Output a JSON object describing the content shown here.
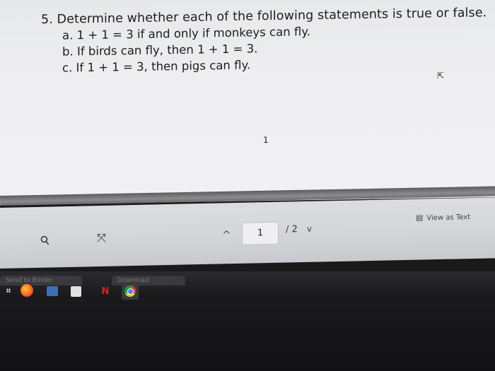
{
  "document": {
    "problem_statement": "5. Determine whether each of the following statements is true or false.",
    "items": [
      "a. 1 + 1 = 3 if and only if monkeys can fly.",
      "b. If birds can fly, then 1 + 1 = 3.",
      "c. If 1 + 1 = 3, then pigs can fly."
    ],
    "page_number": "1"
  },
  "toolbar": {
    "zoom_icon": "magnifier-icon",
    "fit_icon": "fit-to-screen-icon",
    "prev_icon": "^",
    "current_page": "1",
    "total_pages": "/ 2",
    "next_icon": "v",
    "view_as_text": "View as Text"
  },
  "taskbar": {
    "tabs": [
      "Send to Binder",
      "Download"
    ],
    "apps": [
      "firefox-icon",
      "file-explorer-icon",
      "store-icon",
      "netflix-icon",
      "chrome-icon"
    ],
    "netflix_letter": "N"
  }
}
